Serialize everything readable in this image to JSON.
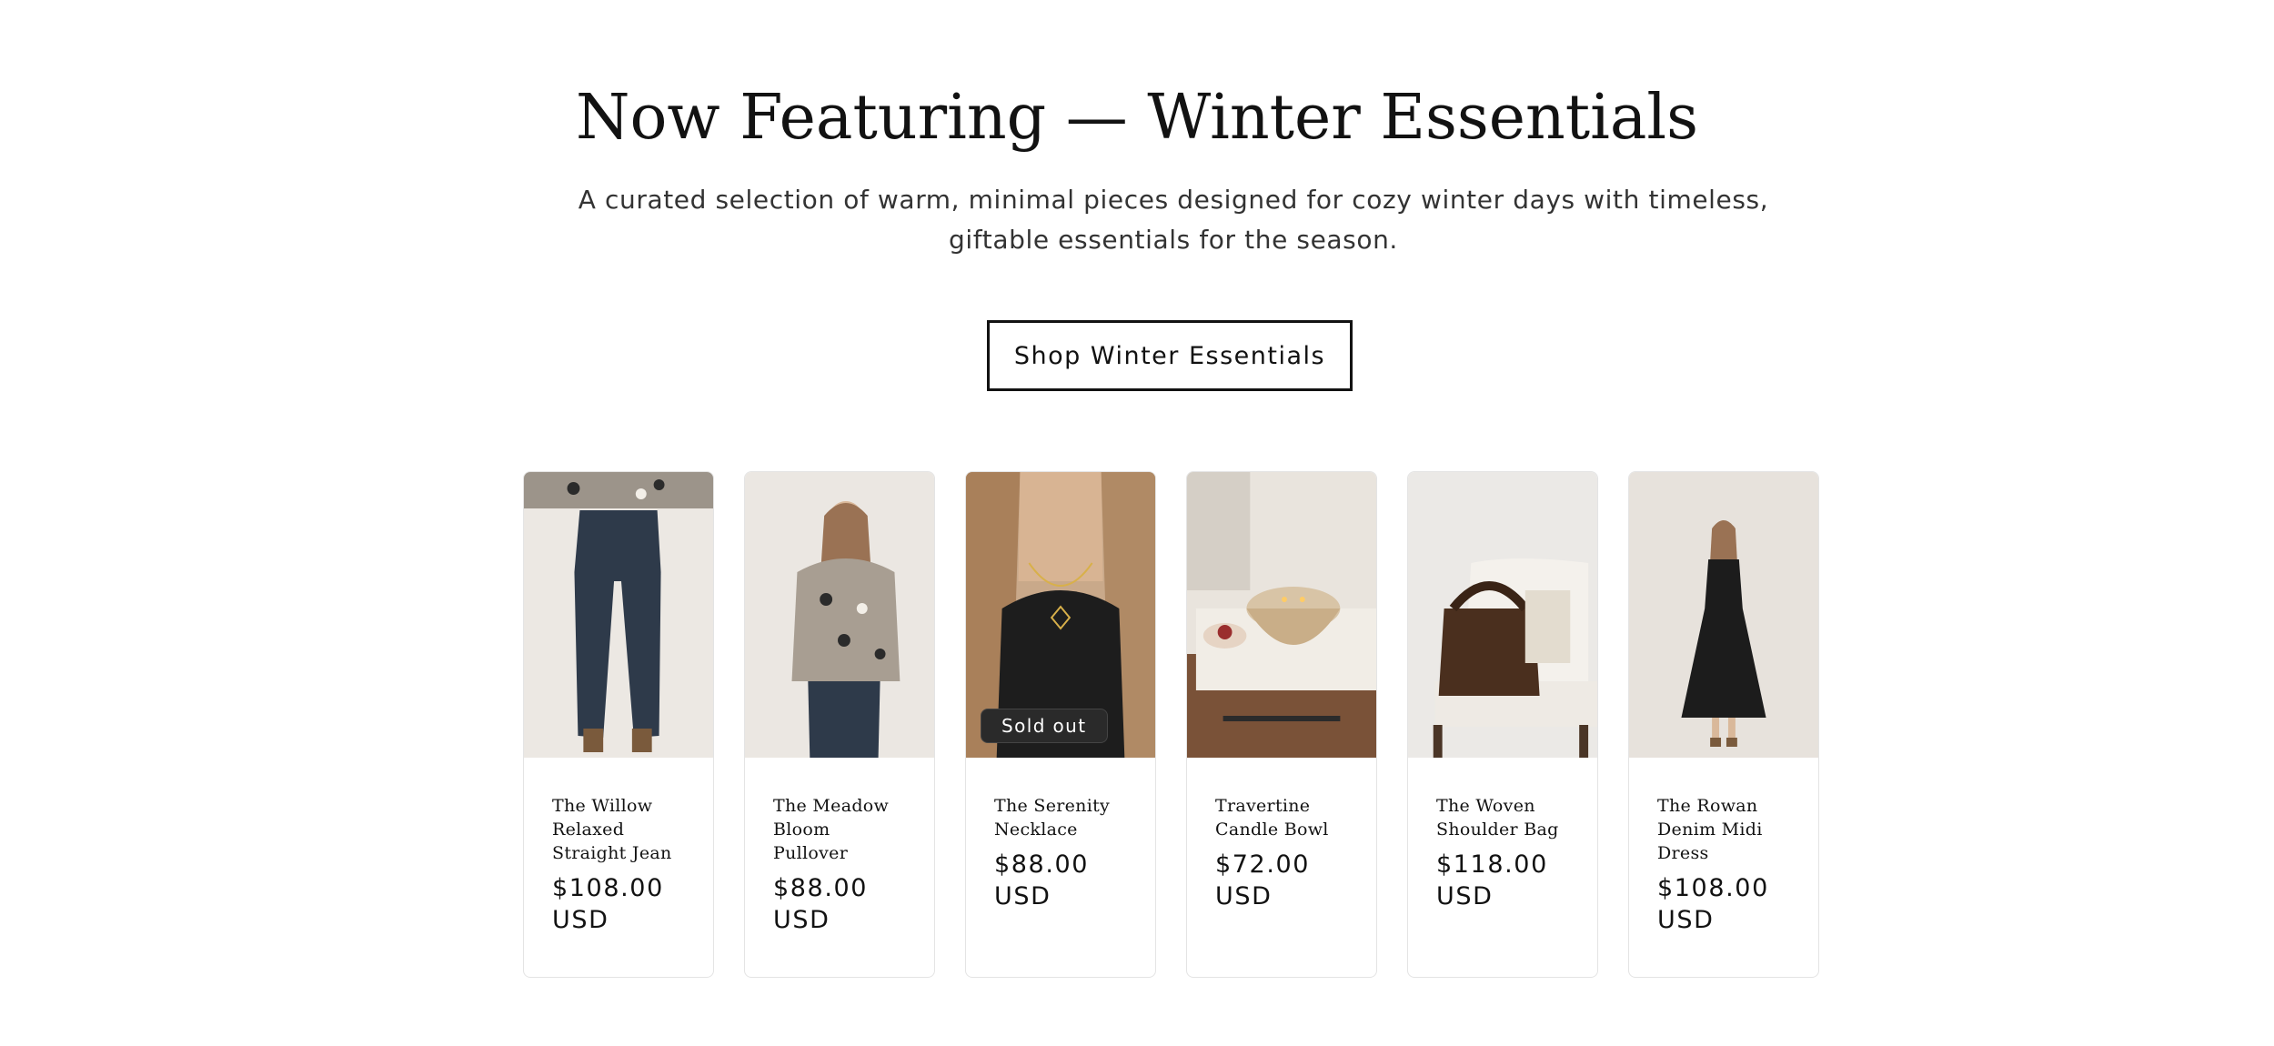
{
  "section": {
    "heading": "Now Featuring — Winter Essentials",
    "subtext": "A curated selection of warm, minimal pieces designed for cozy winter days with timeless, giftable essentials for the season.",
    "cta_label": "Shop Winter Essentials"
  },
  "products": [
    {
      "title": "The Willow Relaxed Straight Jean",
      "price": "$108.00 USD",
      "badge": ""
    },
    {
      "title": "The Meadow Bloom Pullover",
      "price": "$88.00 USD",
      "badge": ""
    },
    {
      "title": "The Serenity Necklace",
      "price": "$88.00 USD",
      "badge": "Sold out"
    },
    {
      "title": "Travertine Candle Bowl",
      "price": "$72.00 USD",
      "badge": ""
    },
    {
      "title": "The Woven Shoulder Bag",
      "price": "$118.00 USD",
      "badge": ""
    },
    {
      "title": "The Rowan Denim Midi Dress",
      "price": "$108.00 USD",
      "badge": ""
    }
  ],
  "colors": {
    "text": "#121212",
    "background": "#ffffff",
    "badge_background": "#2a2a2a"
  }
}
